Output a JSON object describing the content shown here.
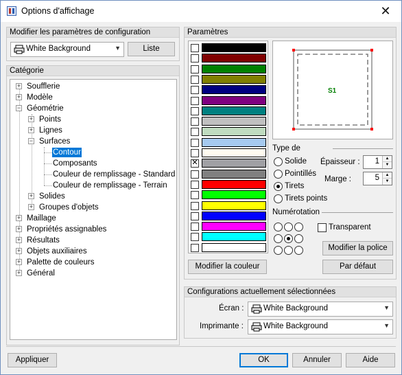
{
  "window": {
    "title": "Options d'affichage"
  },
  "config_group": {
    "title": "Modifier les paramètres de configuration",
    "selected": "White Background",
    "list_button": "Liste"
  },
  "category": {
    "title": "Catégorie",
    "items": [
      "Soufflerie",
      "Modèle",
      "Géométrie",
      "Points",
      "Lignes",
      "Surfaces",
      "Contour",
      "Composants",
      "Couleur de remplissage - Standard",
      "Couleur de remplissage - Terrain",
      "Solides",
      "Groupes d'objets",
      "Maillage",
      "Propriétés assignables",
      "Résultats",
      "Objets auxiliaires",
      "Palette de couleurs",
      "Général"
    ]
  },
  "params": {
    "title": "Paramètres",
    "colors": [
      {
        "hex": "#000000",
        "checked": false
      },
      {
        "hex": "#800000",
        "checked": false
      },
      {
        "hex": "#008000",
        "checked": false
      },
      {
        "hex": "#808000",
        "checked": false
      },
      {
        "hex": "#000080",
        "checked": false
      },
      {
        "hex": "#800080",
        "checked": false
      },
      {
        "hex": "#008080",
        "checked": false
      },
      {
        "hex": "#c0c0c0",
        "checked": false
      },
      {
        "hex": "#c0dcc0",
        "checked": false
      },
      {
        "hex": "#a6caf0",
        "checked": false
      },
      {
        "hex": "#fffbf0",
        "checked": false
      },
      {
        "hex": "#a0a0a4",
        "checked": true
      },
      {
        "hex": "#808080",
        "checked": false
      },
      {
        "hex": "#ff0000",
        "checked": false
      },
      {
        "hex": "#00ff00",
        "checked": false
      },
      {
        "hex": "#ffff00",
        "checked": false
      },
      {
        "hex": "#0000ff",
        "checked": false
      },
      {
        "hex": "#ff00ff",
        "checked": false
      },
      {
        "hex": "#00ffff",
        "checked": false
      },
      {
        "hex": "#ffffff",
        "checked": false
      }
    ],
    "modify_color_button": "Modifier la couleur",
    "preview_label": "S1",
    "line_type": {
      "title": "Type de",
      "options": [
        "Solide",
        "Pointillés",
        "Tirets",
        "Tirets points"
      ],
      "selected": 2
    },
    "thickness": {
      "label": "Épaisseur :",
      "value": "1"
    },
    "margin": {
      "label": "Marge :",
      "value": "5"
    },
    "numbering": {
      "title": "Numérotation",
      "selected": 4
    },
    "transparent_label": "Transparent",
    "modify_font_button": "Modifier la police",
    "default_button": "Par défaut"
  },
  "current_configs": {
    "title": "Configurations actuellement sélectionnées",
    "screen_label": "Écran :",
    "screen_value": "White Background",
    "printer_label": "Imprimante :",
    "printer_value": "White Background"
  },
  "footer": {
    "apply": "Appliquer",
    "ok": "OK",
    "cancel": "Annuler",
    "help": "Aide"
  },
  "colors": {
    "accent": "#0078d7",
    "preview_label": "#008000",
    "preview_corner": "#ff0000"
  }
}
